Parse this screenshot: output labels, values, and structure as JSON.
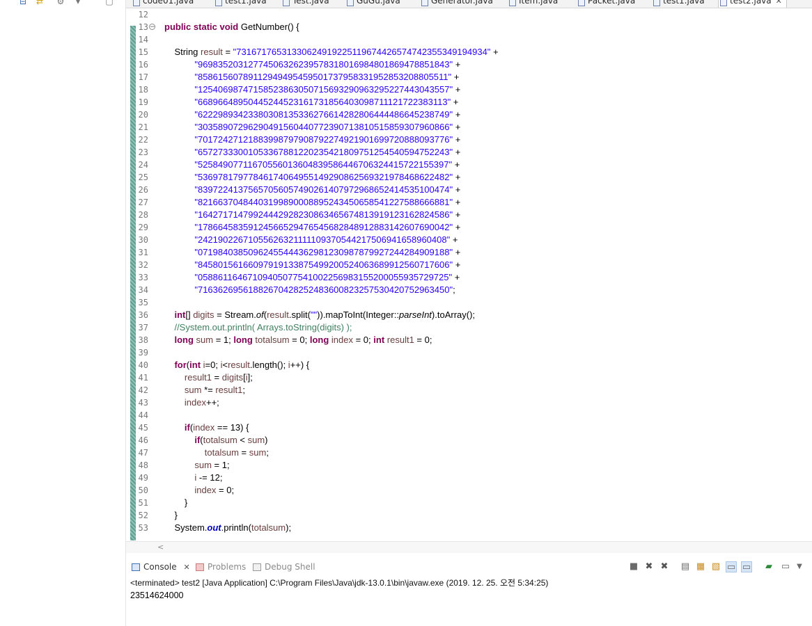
{
  "editor_tabs": [
    {
      "label": "code01.java",
      "active": false
    },
    {
      "label": "test1.java",
      "active": false
    },
    {
      "label": "Test.java",
      "active": false
    },
    {
      "label": "GuGu.java",
      "active": false
    },
    {
      "label": "Generator.java",
      "active": false
    },
    {
      "label": "Item.java",
      "active": false
    },
    {
      "label": "Packet.java",
      "active": false
    },
    {
      "label": "test1.java",
      "active": false
    },
    {
      "label": "test2.java",
      "active": true,
      "close": "✕"
    }
  ],
  "code_lines": [
    {
      "no": "12",
      "html": ""
    },
    {
      "no": "13",
      "fold": "⊖",
      "html": "<span class=\"kw\">public</span> <span class=\"kw\">static</span> <span class=\"kw\">void</span> GetNumber() {"
    },
    {
      "no": "14",
      "html": ""
    },
    {
      "no": "15",
      "html": "    String <span class=\"var\">result</span> = <span class=\"str\">\"73167176531330624919225119674426574742355349194934\"</span> +"
    },
    {
      "no": "16",
      "html": "            <span class=\"str\">\"96983520312774506326239578318016984801869478851843\"</span> +"
    },
    {
      "no": "17",
      "html": "            <span class=\"str\">\"85861560789112949495459501737958331952853208805511\"</span> +"
    },
    {
      "no": "18",
      "html": "            <span class=\"str\">\"12540698747158523863050715693290963295227443043557\"</span> +"
    },
    {
      "no": "19",
      "html": "            <span class=\"str\">\"66896648950445244523161731856403098711121722383113\"</span> +"
    },
    {
      "no": "20",
      "html": "            <span class=\"str\">\"62229893423380308135336276614282806444486645238749\"</span> +"
    },
    {
      "no": "21",
      "html": "            <span class=\"str\">\"30358907296290491560440772390713810515859307960866\"</span> +"
    },
    {
      "no": "22",
      "html": "            <span class=\"str\">\"70172427121883998797908792274921901699720888093776\"</span> +"
    },
    {
      "no": "23",
      "html": "            <span class=\"str\">\"65727333001053367881220235421809751254540594752243\"</span> +"
    },
    {
      "no": "24",
      "html": "            <span class=\"str\">\"52584907711670556013604839586446706324415722155397\"</span> +"
    },
    {
      "no": "25",
      "html": "            <span class=\"str\">\"53697817977846174064955149290862569321978468622482\"</span> +"
    },
    {
      "no": "26",
      "html": "            <span class=\"str\">\"83972241375657056057490261407972968652414535100474\"</span> +"
    },
    {
      "no": "27",
      "html": "            <span class=\"str\">\"82166370484403199890008895243450658541227588666881\"</span> +"
    },
    {
      "no": "28",
      "html": "            <span class=\"str\">\"16427171479924442928230863465674813919123162824586\"</span> +"
    },
    {
      "no": "29",
      "html": "            <span class=\"str\">\"17866458359124566529476545682848912883142607690042\"</span> +"
    },
    {
      "no": "30",
      "html": "            <span class=\"str\">\"24219022671055626321111109370544217506941658960408\"</span> +"
    },
    {
      "no": "31",
      "html": "            <span class=\"str\">\"07198403850962455444362981230987879927244284909188\"</span> +"
    },
    {
      "no": "32",
      "html": "            <span class=\"str\">\"84580156166097919133875499200524063689912560717606\"</span> +"
    },
    {
      "no": "33",
      "html": "            <span class=\"str\">\"05886116467109405077541002256983155200055935729725\"</span> +"
    },
    {
      "no": "34",
      "html": "            <span class=\"str\">\"71636269561882670428252483600823257530420752963450\"</span>;"
    },
    {
      "no": "35",
      "html": ""
    },
    {
      "no": "36",
      "html": "    <span class=\"kw\">int</span>[] <span class=\"var\">digits</span> = Stream.<span class=\"it\">of</span>(<span class=\"var\">result</span>.split(<span class=\"str\">\"\"</span>)).mapToInt(Integer::<span class=\"it\">parseInt</span>).toArray();"
    },
    {
      "no": "37",
      "html": "    <span class=\"cmt\">//System.out.println( Arrays.toString(digits) );</span>"
    },
    {
      "no": "38",
      "html": "    <span class=\"kw\">long</span> <span class=\"var\">sum</span> = 1; <span class=\"kw\">long</span> <span class=\"var\">totalsum</span> = 0; <span class=\"kw\">long</span> <span class=\"var\">index</span> = 0; <span class=\"kw\">int</span> <span class=\"var\">result1</span> = 0;"
    },
    {
      "no": "39",
      "html": ""
    },
    {
      "no": "40",
      "html": "    <span class=\"kw\">for</span>(<span class=\"kw\">int</span> <span class=\"var\">i</span>=0; <span class=\"var\">i</span>&lt;<span class=\"var\">result</span>.length(); <span class=\"var\">i</span>++) {"
    },
    {
      "no": "41",
      "html": "        <span class=\"var\">result1</span> = <span class=\"var\">digits</span>[<span class=\"var\">i</span>];"
    },
    {
      "no": "42",
      "html": "        <span class=\"var\">sum</span> *= <span class=\"var\">result1</span>;"
    },
    {
      "no": "43",
      "html": "        <span class=\"var\">index</span>++;"
    },
    {
      "no": "44",
      "html": ""
    },
    {
      "no": "45",
      "html": "        <span class=\"kw\">if</span>(<span class=\"var\">index</span> == 13) {"
    },
    {
      "no": "46",
      "html": "            <span class=\"kw\">if</span>(<span class=\"var\">totalsum</span> &lt; <span class=\"var\">sum</span>)"
    },
    {
      "no": "47",
      "html": "                <span class=\"var\">totalsum</span> = <span class=\"var\">sum</span>;"
    },
    {
      "no": "48",
      "html": "            <span class=\"var\">sum</span> = 1;"
    },
    {
      "no": "49",
      "html": "            <span class=\"var\">i</span> -= 12;"
    },
    {
      "no": "50",
      "html": "            <span class=\"var\">index</span> = 0;"
    },
    {
      "no": "51",
      "html": "        }"
    },
    {
      "no": "52",
      "html": "    }"
    },
    {
      "no": "53",
      "html": "    System.<span class=\"fld\">out</span>.println(<span class=\"var\">totalsum</span>);"
    }
  ],
  "console": {
    "tabs": [
      {
        "label": "Console",
        "close": "✕",
        "active": true
      },
      {
        "label": "Problems",
        "active": false
      },
      {
        "label": "Debug Shell",
        "active": false
      }
    ],
    "status": "<terminated> test2 [Java Application] C:\\Program Files\\Java\\jdk-13.0.1\\bin\\javaw.exe (2019. 12. 25. 오전 5:34:25)",
    "output": "23514624000"
  }
}
